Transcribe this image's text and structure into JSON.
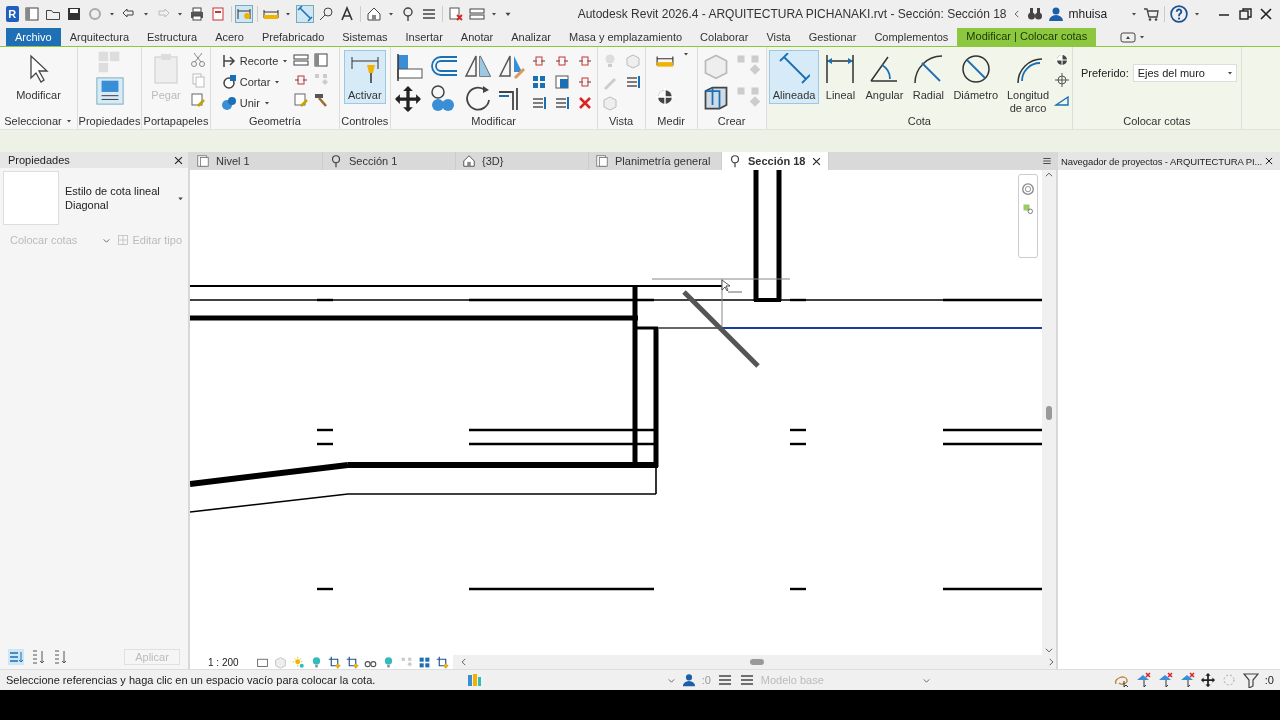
{
  "window": {
    "logo": "R",
    "title": "Autodesk Revit 2026.4 - ARQUITECTURA PICHANAKI.rvt - Sección: Sección 18",
    "user": "mhuisa"
  },
  "ribbon_tabs": [
    {
      "label": "Archivo",
      "kind": "file",
      "selected": false
    },
    {
      "label": "Arquitectura",
      "kind": "tab",
      "selected": false
    },
    {
      "label": "Estructura",
      "kind": "tab",
      "selected": false
    },
    {
      "label": "Acero",
      "kind": "tab",
      "selected": false
    },
    {
      "label": "Prefabricado",
      "kind": "tab",
      "selected": false
    },
    {
      "label": "Sistemas",
      "kind": "tab",
      "selected": false
    },
    {
      "label": "Insertar",
      "kind": "tab",
      "selected": false
    },
    {
      "label": "Anotar",
      "kind": "tab",
      "selected": false
    },
    {
      "label": "Analizar",
      "kind": "tab",
      "selected": false
    },
    {
      "label": "Masa y emplazamiento",
      "kind": "tab",
      "selected": false
    },
    {
      "label": "Colaborar",
      "kind": "tab",
      "selected": false
    },
    {
      "label": "Vista",
      "kind": "tab",
      "selected": false
    },
    {
      "label": "Gestionar",
      "kind": "tab",
      "selected": false
    },
    {
      "label": "Complementos",
      "kind": "tab",
      "selected": false
    },
    {
      "label": "Modificar | Colocar cotas",
      "kind": "contextual",
      "selected": true
    }
  ],
  "ribbon_panels": [
    {
      "kind": "select",
      "label": "Seleccionar",
      "tools": [
        {
          "label": "Modificar",
          "selected": false,
          "disabled": false
        }
      ]
    },
    {
      "kind": "properties",
      "label": "Propiedades"
    },
    {
      "kind": "clipboard",
      "label": "Portapapeles",
      "tools": [
        {
          "label": "Pegar",
          "selected": false,
          "disabled": true
        }
      ]
    },
    {
      "kind": "geometry",
      "label": "Geometría",
      "tools": [
        {
          "label": "Recorte",
          "selected": false,
          "disabled": false
        },
        {
          "label": "Cortar",
          "selected": false,
          "disabled": false
        },
        {
          "label": "Unir",
          "selected": false,
          "disabled": false
        }
      ]
    },
    {
      "kind": "controls",
      "label": "Controles",
      "tools": [
        {
          "label": "Activar",
          "selected": true,
          "disabled": false
        }
      ]
    },
    {
      "kind": "modify",
      "label": "Modificar"
    },
    {
      "kind": "view",
      "label": "Vista"
    },
    {
      "kind": "measure",
      "label": "Medir"
    },
    {
      "kind": "create",
      "label": "Crear"
    },
    {
      "kind": "dimension",
      "label": "Cota",
      "tools": [
        {
          "label": "Alineada",
          "selected": true,
          "disabled": false
        },
        {
          "label": "Lineal",
          "selected": false,
          "disabled": false
        },
        {
          "label": "Angular",
          "selected": false,
          "disabled": false
        },
        {
          "label": "Radial",
          "selected": false,
          "disabled": false
        },
        {
          "label": "Diámetro",
          "selected": false,
          "disabled": false
        },
        {
          "label": "Longitud de arco",
          "selected": false,
          "disabled": false
        }
      ]
    },
    {
      "kind": "placement",
      "label": "Colocar cotas",
      "field": {
        "label": "Preferido:",
        "value": "Ejes del muro"
      }
    }
  ],
  "properties": {
    "title": "Propiedades",
    "type_family": "Estilo de cota lineal",
    "type_name": "Diagonal",
    "filter": {
      "label": "Colocar cotas",
      "disabled": true
    },
    "edit_type": {
      "label": "Editar tipo",
      "disabled": true
    },
    "apply": {
      "label": "Aplicar",
      "disabled": true
    }
  },
  "view_tabs": [
    {
      "label": "Nivel 1",
      "kind": "plan",
      "selected": false
    },
    {
      "label": "Sección 1",
      "kind": "section",
      "selected": false
    },
    {
      "label": "{3D}",
      "kind": "model",
      "selected": false
    },
    {
      "label": "Planimetría general",
      "kind": "plan",
      "selected": false
    },
    {
      "label": "Sección 18",
      "kind": "section",
      "selected": true
    }
  ],
  "view_controls": {
    "scale": "1 : 200"
  },
  "project_browser": {
    "title": "Navegador de proyectos - ARQUITECTURA PI..."
  },
  "status_bar": {
    "message": "Seleccione referencias y haga clic en un espacio vacío para colocar la cota.",
    "editable_count": ":0",
    "workset": {
      "label": "Modelo base",
      "disabled": true
    },
    "filter_count": ":0"
  }
}
